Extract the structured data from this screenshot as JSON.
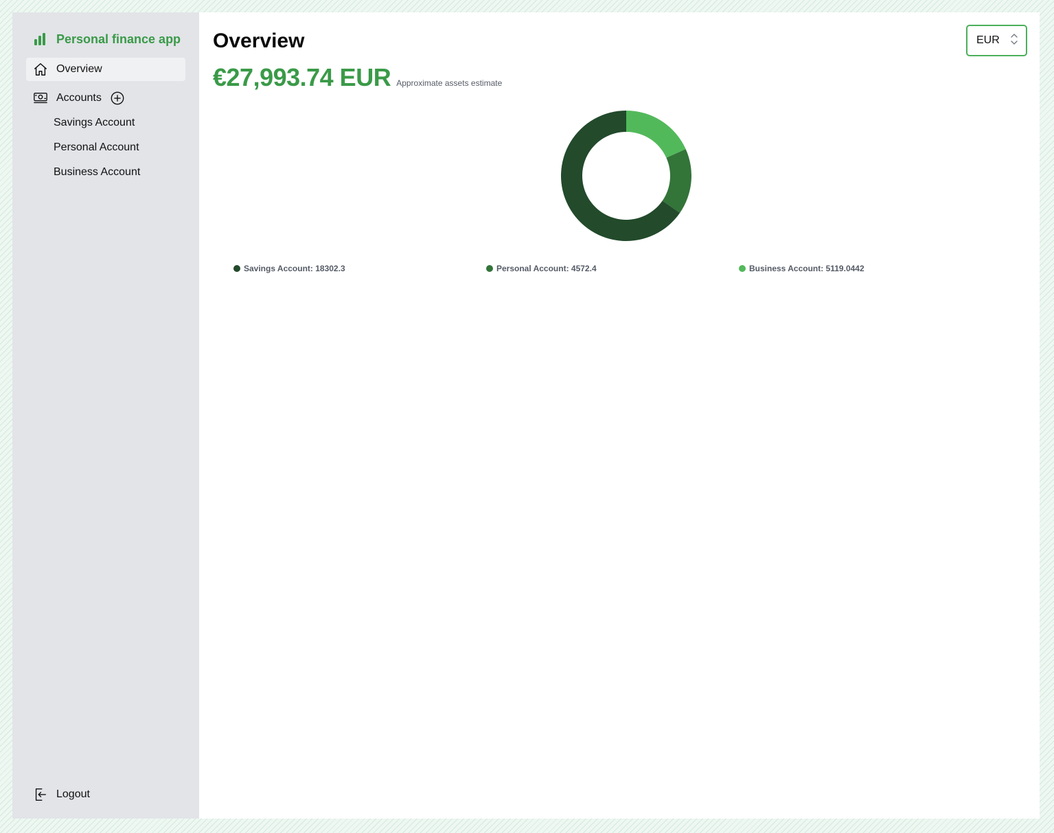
{
  "brand": {
    "name": "Personal finance app",
    "icon": "bar-chart-icon",
    "color": "#3a9a48"
  },
  "sidebar": {
    "overview": {
      "label": "Overview",
      "icon": "home-icon"
    },
    "accounts": {
      "label": "Accounts",
      "icon": "banknote-icon",
      "add_icon": "plus-circle-icon"
    },
    "account_items": [
      {
        "label": "Savings Account"
      },
      {
        "label": "Personal Account"
      },
      {
        "label": "Business Account"
      }
    ],
    "logout": {
      "label": "Logout",
      "icon": "logout-icon"
    }
  },
  "header": {
    "title": "Overview",
    "currency": {
      "selected": "EUR",
      "icon": "chevron-up-down-icon"
    }
  },
  "summary": {
    "total": "€27,993.74 EUR",
    "caption": "Approximate assets estimate"
  },
  "chart_data": {
    "type": "pie",
    "donut": true,
    "categories": [
      "Savings Account",
      "Personal Account",
      "Business Account"
    ],
    "values": [
      18302.3,
      4572.4,
      5119.0442
    ],
    "colors": [
      "#224a2b",
      "#337439",
      "#52b95b"
    ],
    "legend": [
      "Savings Account: 18302.3",
      "Personal Account: 4572.4",
      "Business Account: 5119.0442"
    ],
    "legend_position": "bottom"
  }
}
